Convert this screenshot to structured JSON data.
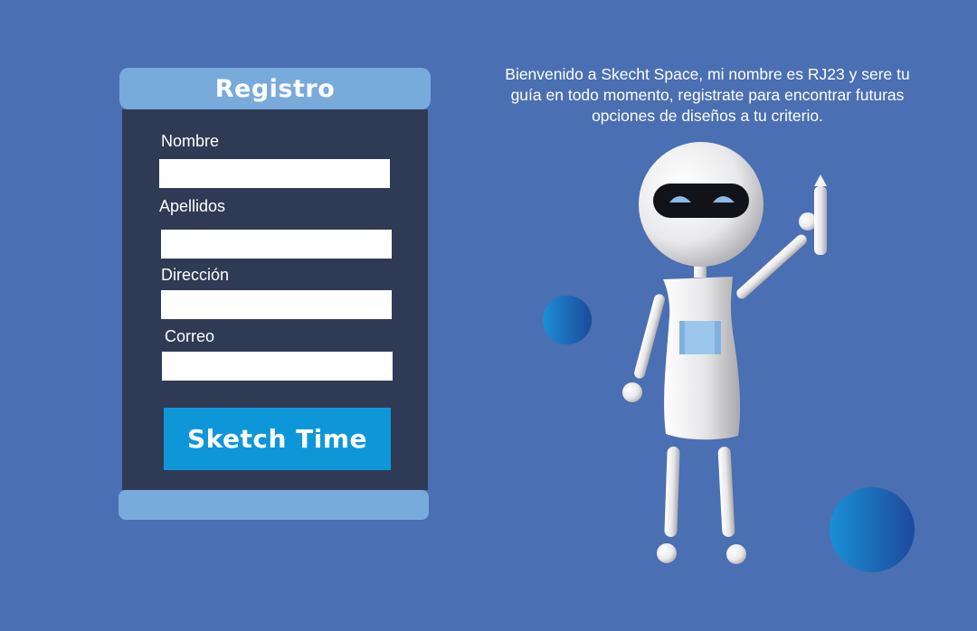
{
  "form": {
    "title": "Registro",
    "fields": [
      {
        "label": "Nombre",
        "value": ""
      },
      {
        "label": "Apellidos",
        "value": ""
      },
      {
        "label": "Dirección",
        "value": ""
      },
      {
        "label": "Correo",
        "value": ""
      }
    ],
    "submit_label": "Sketch Time"
  },
  "welcome": {
    "lines": [
      "Bienvenido a  Skecht Space, mi nombre es RJ23 y sere tu",
      "guía en todo momento, registrate para encontrar futuras",
      "opciones de diseños a tu criterio."
    ]
  },
  "illustration": {
    "character": "robot",
    "icons": [
      "robot-illustration",
      "pencil-icon",
      "decorative-sphere"
    ]
  },
  "colors": {
    "background": "#4a6fb2",
    "panel": "#2f3b55",
    "panel_accent": "#78aadc",
    "button": "#0e97d8"
  }
}
